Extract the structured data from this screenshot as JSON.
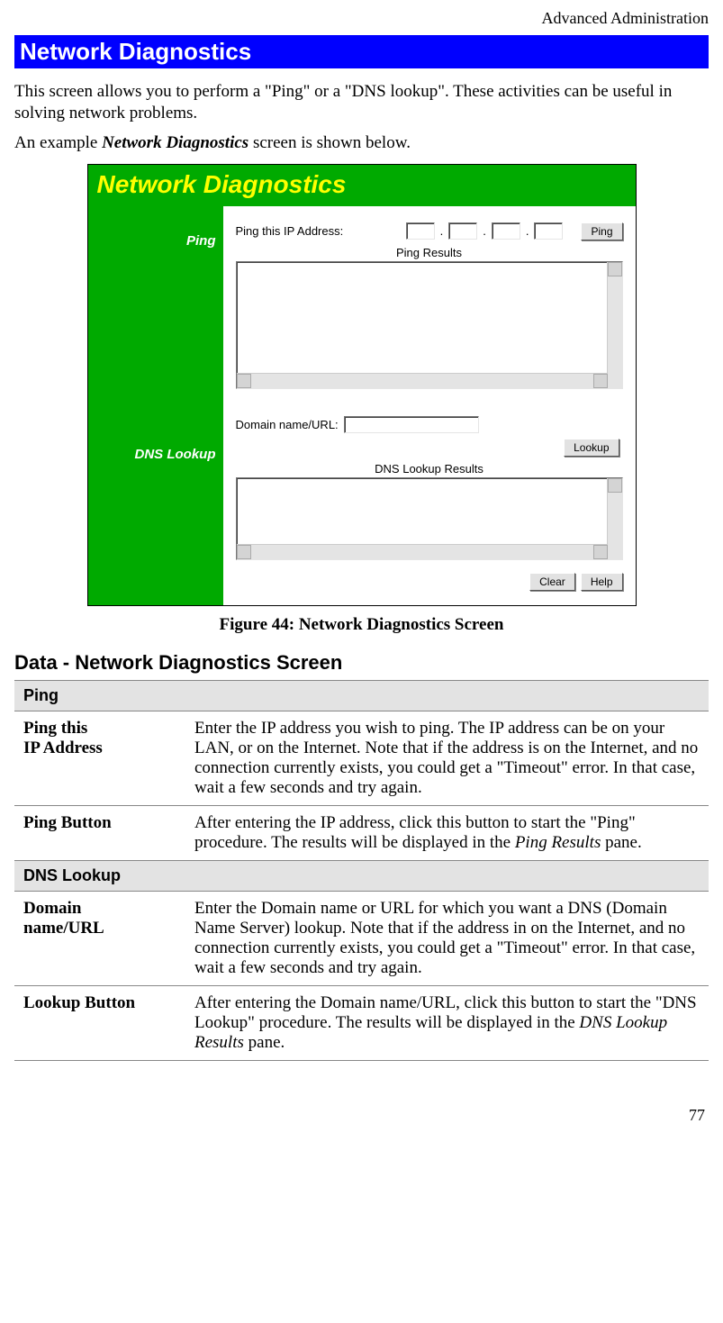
{
  "header": {
    "breadcrumb": "Advanced Administration"
  },
  "section": {
    "title": "Network Diagnostics",
    "intro1": "This screen allows you to perform a \"Ping\" or a \"DNS lookup\". These activities can be useful in solving network problems.",
    "intro2_pre": "An example ",
    "intro2_em": "Network Diagnostics",
    "intro2_post": " screen is shown below."
  },
  "screenshot": {
    "title": "Network Diagnostics",
    "side": {
      "ping": "Ping",
      "dns": "DNS Lookup"
    },
    "ping": {
      "label": "Ping this IP Address:",
      "ip": [
        "",
        "",
        "",
        ""
      ],
      "button": "Ping",
      "results_label": "Ping Results"
    },
    "dns": {
      "label": "Domain name/URL:",
      "value": "",
      "button": "Lookup",
      "results_label": "DNS Lookup Results"
    },
    "footer": {
      "clear": "Clear",
      "help": "Help"
    }
  },
  "figure_caption": "Figure 44: Network Diagnostics Screen",
  "data_heading": "Data - Network Diagnostics Screen",
  "table": {
    "group_ping": "Ping",
    "row1_key_a": "Ping this",
    "row1_key_b": "IP Address",
    "row1_val": "Enter the IP address you wish to ping. The IP address can be on your LAN, or on the Internet. Note that if the address is on the Internet, and no connection currently exists, you could get a \"Timeout\" error. In that case, wait a few seconds and try again.",
    "row2_key": "Ping Button",
    "row2_val_pre": "After entering the IP address, click this button to start the \"Ping\" procedure. The results will be displayed in the ",
    "row2_val_em": "Ping Results",
    "row2_val_post": " pane.",
    "group_dns": "DNS Lookup",
    "row3_key_a": "Domain",
    "row3_key_b": "name/URL",
    "row3_val": "Enter the Domain name or URL for which you want a DNS (Domain Name Server) lookup. Note that if the address in on the Internet, and no connection currently exists, you could get a \"Timeout\" error. In that case, wait a few seconds and try again.",
    "row4_key": "Lookup Button",
    "row4_val_pre": "After entering the Domain name/URL, click this button to start the \"DNS Lookup\" procedure. The results will be displayed in the ",
    "row4_val_em": "DNS Lookup Results",
    "row4_val_post": " pane."
  },
  "page_number": "77"
}
